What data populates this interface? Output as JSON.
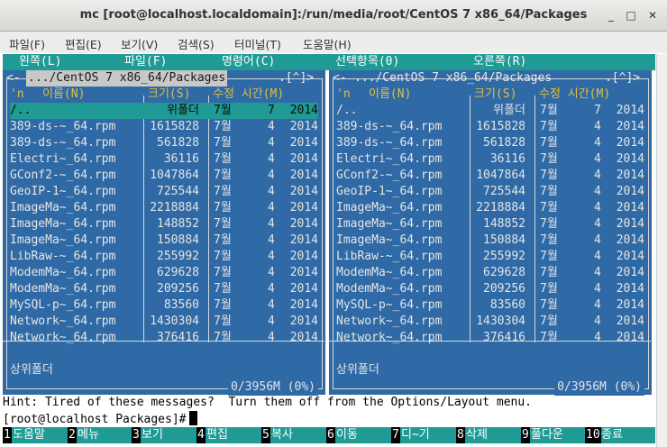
{
  "window": {
    "title": "mc [root@localhost.localdomain]:/run/media/root/CentOS 7 x86_64/Packages",
    "minimize_glyph": "_",
    "maximize_glyph": "□",
    "close_glyph": "✕"
  },
  "menubar": [
    "파일(F)",
    "편집(E)",
    "보기(V)",
    "검색(S)",
    "터미널(T)",
    "도움말(H)"
  ],
  "mc_menu": [
    "왼쪽(L)",
    "파일(F)",
    "명령어(C)",
    "선택항목(0)",
    "오른쪽(R)"
  ],
  "panels": {
    "left": {
      "path": ".../CentOS 7 x86_64/Packages",
      "path_left": "<-",
      "path_right": ".[^]>",
      "header": {
        "n": "'n",
        "name": "이름(N)",
        "size": "크기(S)",
        "mtime": "수정 시간(M)"
      },
      "status": "상위폴더",
      "free": "0/3956M (0%)"
    },
    "right": {
      "path": ".../CentOS 7 x86_64/Packages",
      "path_left": "<-",
      "path_right": ".[^]>",
      "header": {
        "n": "'n",
        "name": "이름(N)",
        "size": "크기(S)",
        "mtime": "수정 시간(M)"
      },
      "status": "상위폴더",
      "free": "0/3956M (0%)"
    }
  },
  "files": [
    {
      "name": "/..",
      "size": "위폴더",
      "month": "7월",
      "day": "7",
      "year": "2014"
    },
    {
      "name": "389-ds-~_64.rpm",
      "size": "1615828",
      "month": "7월",
      "day": "4",
      "year": "2014"
    },
    {
      "name": "389-ds-~_64.rpm",
      "size": "561828",
      "month": "7월",
      "day": "4",
      "year": "2014"
    },
    {
      "name": "Electri~_64.rpm",
      "size": "36116",
      "month": "7월",
      "day": "4",
      "year": "2014"
    },
    {
      "name": "GConf2-~_64.rpm",
      "size": "1047864",
      "month": "7월",
      "day": "4",
      "year": "2014"
    },
    {
      "name": "GeoIP-1~_64.rpm",
      "size": "725544",
      "month": "7월",
      "day": "4",
      "year": "2014"
    },
    {
      "name": "ImageMa~_64.rpm",
      "size": "2218884",
      "month": "7월",
      "day": "4",
      "year": "2014"
    },
    {
      "name": "ImageMa~_64.rpm",
      "size": "148852",
      "month": "7월",
      "day": "4",
      "year": "2014"
    },
    {
      "name": "ImageMa~_64.rpm",
      "size": "150884",
      "month": "7월",
      "day": "4",
      "year": "2014"
    },
    {
      "name": "LibRaw-~_64.rpm",
      "size": "255992",
      "month": "7월",
      "day": "4",
      "year": "2014"
    },
    {
      "name": "ModemMa~_64.rpm",
      "size": "629628",
      "month": "7월",
      "day": "4",
      "year": "2014"
    },
    {
      "name": "ModemMa~_64.rpm",
      "size": "209256",
      "month": "7월",
      "day": "4",
      "year": "2014"
    },
    {
      "name": "MySQL-p~_64.rpm",
      "size": "83560",
      "month": "7월",
      "day": "4",
      "year": "2014"
    },
    {
      "name": "Network~_64.rpm",
      "size": "1430304",
      "month": "7월",
      "day": "4",
      "year": "2014"
    },
    {
      "name": "Network~_64.rpm",
      "size": "376416",
      "month": "7월",
      "day": "4",
      "year": "2014"
    }
  ],
  "hint": "Hint: Tired of these messages?  Turn them off from the Options/Layout menu.",
  "prompt": "[root@localhost Packages]#",
  "fkeys": [
    {
      "num": "1",
      "label": "도움말"
    },
    {
      "num": "2",
      "label": "메뉴"
    },
    {
      "num": "3",
      "label": "보기"
    },
    {
      "num": "4",
      "label": "편집"
    },
    {
      "num": "5",
      "label": "복사"
    },
    {
      "num": "6",
      "label": "이동"
    },
    {
      "num": "7",
      "label": "디~기"
    },
    {
      "num": "8",
      "label": "삭제"
    },
    {
      "num": "9",
      "label": "풀다운"
    },
    {
      "num": "10",
      "label": "종료"
    }
  ],
  "colors": {
    "panel_bg": "#2f6aa6",
    "menu_bg": "#1f9a94",
    "header_fg": "#e0c03a"
  }
}
